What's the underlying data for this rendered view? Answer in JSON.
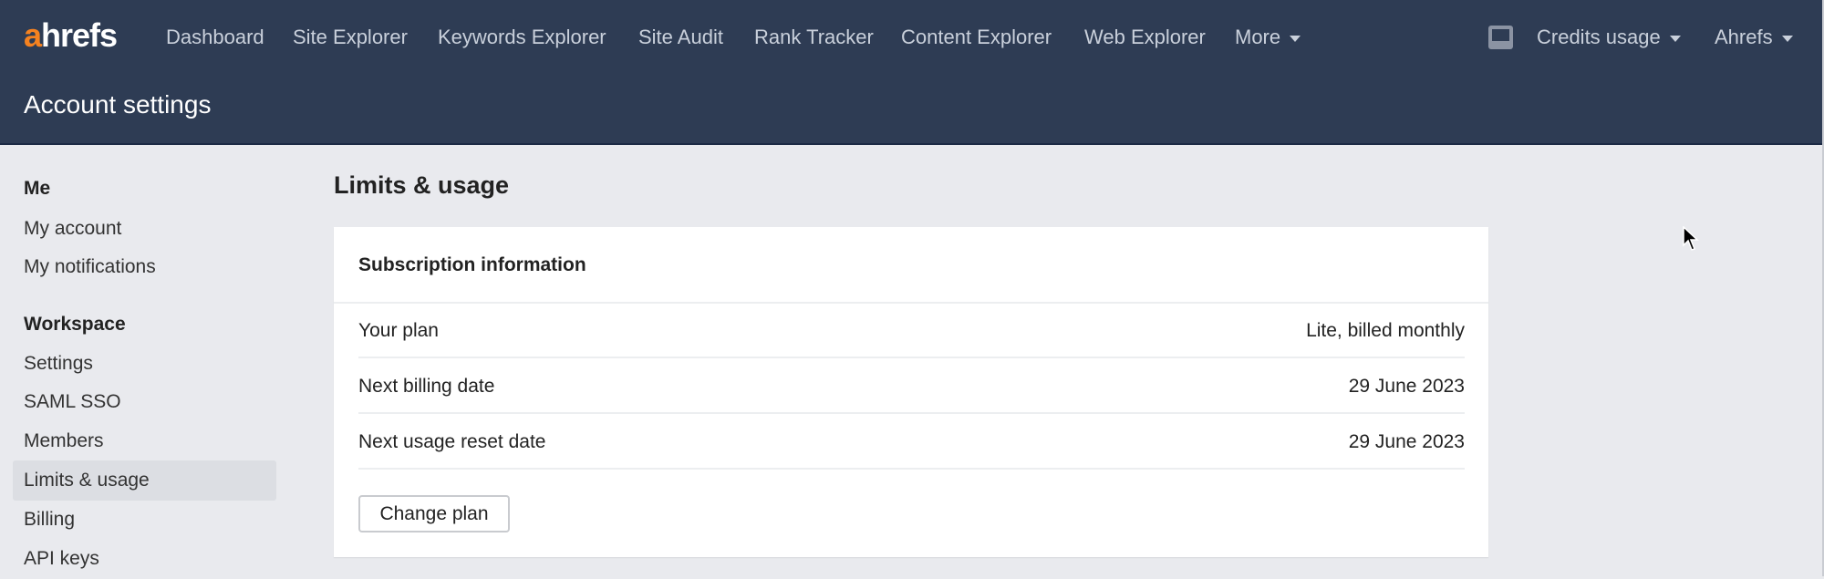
{
  "header": {
    "logo_a": "a",
    "logo_rest": "hrefs",
    "nav": [
      "Dashboard",
      "Site Explorer",
      "Keywords Explorer",
      "Site Audit",
      "Rank Tracker",
      "Content Explorer",
      "Web Explorer",
      "More"
    ],
    "credits": "Credits usage",
    "account": "Ahrefs",
    "title": "Account settings"
  },
  "sidebar": {
    "me_heading": "Me",
    "me_items": [
      "My account",
      "My notifications"
    ],
    "workspace_heading": "Workspace",
    "workspace_items": [
      "Settings",
      "SAML SSO",
      "Members",
      "Limits & usage",
      "Billing",
      "API keys"
    ]
  },
  "main": {
    "title": "Limits & usage",
    "card_title": "Subscription information",
    "rows": [
      {
        "label": "Your plan",
        "value": "Lite, billed monthly"
      },
      {
        "label": "Next billing date",
        "value": "29 June 2023"
      },
      {
        "label": "Next usage reset date",
        "value": "29 June 2023"
      }
    ],
    "button": "Change plan"
  }
}
